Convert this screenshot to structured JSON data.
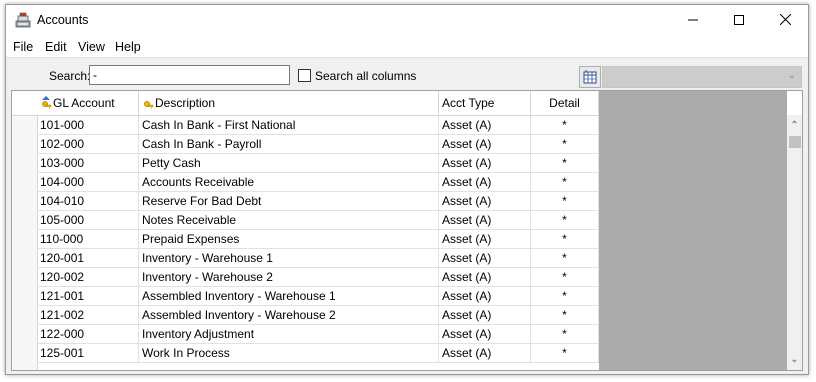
{
  "window": {
    "title": "Accounts"
  },
  "menu": [
    "File",
    "Edit",
    "View",
    "Help"
  ],
  "search": {
    "label": "Search:",
    "value": "-",
    "all_columns_label": "Search all columns",
    "all_columns_checked": false
  },
  "columns": [
    "GL Account",
    "Description",
    "Acct Type",
    "Detail"
  ],
  "rows": [
    {
      "account": "101-000",
      "description": "Cash In Bank - First National",
      "type": "Asset (A)",
      "detail": "*"
    },
    {
      "account": "102-000",
      "description": "Cash In Bank - Payroll",
      "type": "Asset (A)",
      "detail": "*"
    },
    {
      "account": "103-000",
      "description": "Petty Cash",
      "type": "Asset (A)",
      "detail": "*"
    },
    {
      "account": "104-000",
      "description": "Accounts Receivable",
      "type": "Asset (A)",
      "detail": "*"
    },
    {
      "account": "104-010",
      "description": "Reserve For Bad Debt",
      "type": "Asset (A)",
      "detail": "*"
    },
    {
      "account": "105-000",
      "description": "Notes Receivable",
      "type": "Asset (A)",
      "detail": "*"
    },
    {
      "account": "110-000",
      "description": "Prepaid Expenses",
      "type": "Asset (A)",
      "detail": "*"
    },
    {
      "account": "120-001",
      "description": "Inventory - Warehouse 1",
      "type": "Asset (A)",
      "detail": "*"
    },
    {
      "account": "120-002",
      "description": "Inventory - Warehouse 2",
      "type": "Asset (A)",
      "detail": "*"
    },
    {
      "account": "121-001",
      "description": "Assembled Inventory - Warehouse 1",
      "type": "Asset (A)",
      "detail": "*"
    },
    {
      "account": "121-002",
      "description": "Assembled Inventory - Warehouse 2",
      "type": "Asset (A)",
      "detail": "*"
    },
    {
      "account": "122-000",
      "description": "Inventory Adjustment",
      "type": "Asset (A)",
      "detail": "*"
    },
    {
      "account": "125-001",
      "description": "Work In Process",
      "type": "Asset (A)",
      "detail": "*"
    }
  ]
}
